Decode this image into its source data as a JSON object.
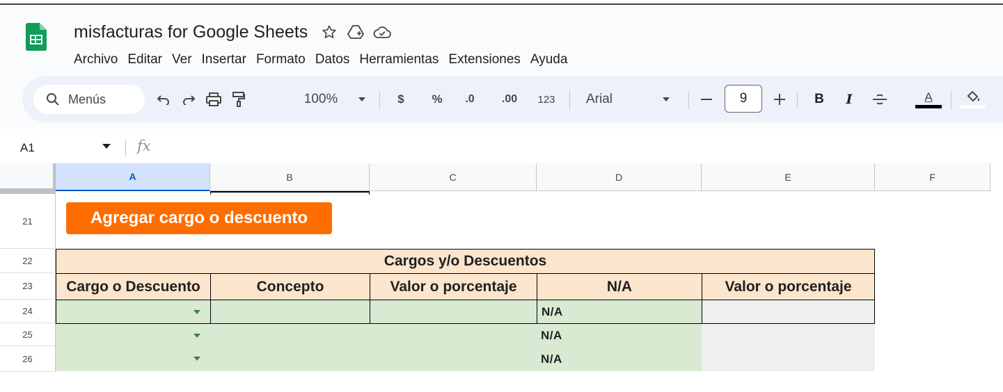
{
  "app": {
    "title": "misfacturas for Google Sheets",
    "brand_color": "#0f9d58"
  },
  "menu": [
    "Archivo",
    "Editar",
    "Ver",
    "Insertar",
    "Formato",
    "Datos",
    "Herramientas",
    "Extensiones",
    "Ayuda"
  ],
  "toolbar": {
    "search_label": "Menús",
    "zoom": "100%",
    "currency": "$",
    "percent": "%",
    "dec_decrease": ".0",
    "dec_increase": ".00",
    "number_format": "123",
    "font": "Arial",
    "font_size": "9",
    "bold": "B",
    "italic": "I",
    "text_color": "A"
  },
  "formula_bar": {
    "cell_ref": "A1",
    "fx": "fx"
  },
  "columns": [
    "A",
    "B",
    "C",
    "D",
    "E",
    "F"
  ],
  "selected_column": "A",
  "rows": [
    "21",
    "22",
    "23",
    "24",
    "25",
    "26"
  ],
  "sheet": {
    "button_label": "Agregar cargo o descuento",
    "table_title": "Cargos y/o Descuentos",
    "headers": [
      "Cargo o Descuento",
      "Concepto",
      "Valor o porcentaje",
      "N/A",
      "Valor o porcentaje"
    ],
    "na_values": [
      "N/A",
      "N/A",
      "N/A"
    ],
    "colors": {
      "header_fill": "#fce5cd",
      "input_fill": "#d9ead3",
      "output_fill": "#efefef",
      "button_fill": "#ff6d01"
    }
  }
}
